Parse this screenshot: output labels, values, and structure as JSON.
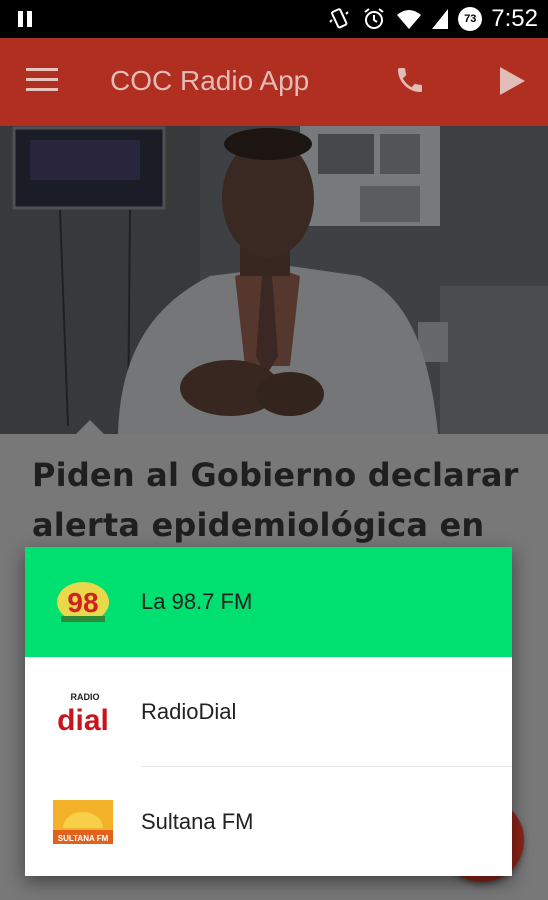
{
  "status_bar": {
    "time": "7:52",
    "battery_level": "73",
    "icons": [
      "pause-icon",
      "vibrate-icon",
      "alarm-icon",
      "wifi-icon",
      "signal-icon",
      "battery-icon"
    ]
  },
  "app_bar": {
    "title": "COC Radio App",
    "color": "#b02f21",
    "icons": [
      "menu-icon",
      "phone-icon",
      "play-icon"
    ]
  },
  "article": {
    "headline": "Piden al Gobierno declarar alerta epidemiológica en la"
  },
  "station_dialog": {
    "selected_color": "#00e070",
    "stations": [
      {
        "name": "La 98.7 FM",
        "logo_text": "98",
        "selected": true
      },
      {
        "name": "RadioDial",
        "logo_text": "dial",
        "selected": false
      },
      {
        "name": "Sultana FM",
        "logo_text": "SULTANA FM",
        "selected": false
      }
    ]
  }
}
